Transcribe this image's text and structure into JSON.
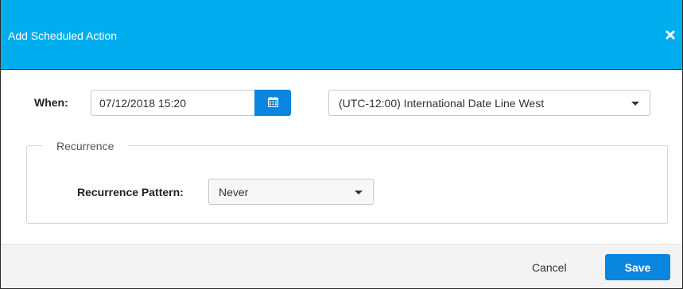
{
  "dialog": {
    "title": "Add Scheduled Action",
    "close_icon": "close-icon",
    "accent_color": "#00aeef",
    "button_color": "#0a86e0"
  },
  "when": {
    "label": "When:",
    "datetime_value": "07/12/2018 15:20",
    "calendar_icon": "calendar-icon",
    "timezone": "(UTC-12:00) International Date Line West"
  },
  "recurrence": {
    "legend": "Recurrence",
    "pattern_label": "Recurrence Pattern:",
    "pattern_value": "Never"
  },
  "footer": {
    "cancel_label": "Cancel",
    "save_label": "Save"
  }
}
